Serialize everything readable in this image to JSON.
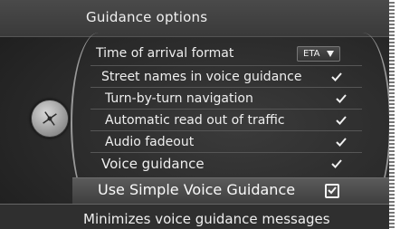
{
  "header": {
    "title": "Guidance options"
  },
  "menu": {
    "time_format": {
      "label": "Time of arrival format",
      "value": "ETA"
    },
    "items": [
      {
        "label": "Street names in voice guidance",
        "checked": true
      },
      {
        "label": "Turn-by-turn navigation",
        "checked": true
      },
      {
        "label": "Automatic read out of traffic",
        "checked": true
      },
      {
        "label": "Audio fadeout",
        "checked": true
      },
      {
        "label": "Voice guidance",
        "checked": true
      }
    ],
    "selected_item": {
      "label": "Use Simple Voice Guidance",
      "checked": true
    }
  },
  "footer": {
    "text": "Minimizes voice guidance messages"
  },
  "colors": {
    "background": "#2c2c2c",
    "text": "#efefef",
    "highlight": "#4e4e4e"
  }
}
